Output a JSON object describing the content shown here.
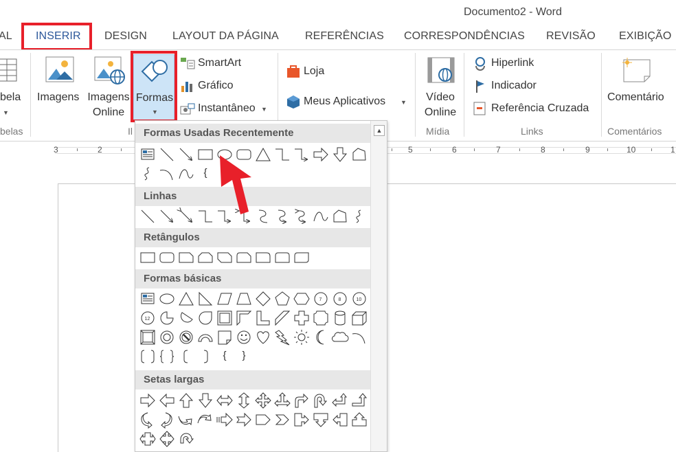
{
  "window": {
    "title": "Documento2 - Word"
  },
  "tabs": [
    {
      "label": "AL"
    },
    {
      "label": "INSERIR"
    },
    {
      "label": "DESIGN"
    },
    {
      "label": "LAYOUT DA PÁGINA"
    },
    {
      "label": "REFERÊNCIAS"
    },
    {
      "label": "CORRESPONDÊNCIAS"
    },
    {
      "label": "REVISÃO"
    },
    {
      "label": "EXIBIÇÃO"
    }
  ],
  "ribbon": {
    "tabela": {
      "label": "bela",
      "group": "belas"
    },
    "imagens": {
      "label": "Imagens"
    },
    "imagens_online": {
      "line1": "Imagens",
      "line2": "Online"
    },
    "formas": {
      "label": "Formas"
    },
    "ilustr_group": "Il",
    "smartart": "SmartArt",
    "grafico": "Gráfico",
    "instantaneo": "Instantâneo",
    "loja": "Loja",
    "meus_aplicativos": "Meus Aplicativos",
    "video": {
      "line1": "Vídeo",
      "line2": "Online",
      "group": "Mídia"
    },
    "hiperlink": "Hiperlink",
    "indicador": "Indicador",
    "referencia_cruzada": "Referência Cruzada",
    "links_group": "Links",
    "comentario": "Comentário",
    "comentarios_group": "Comentários"
  },
  "ruler": {
    "numbers": [
      "3",
      "2",
      "5",
      "6",
      "7",
      "8",
      "9",
      "10",
      "1"
    ]
  },
  "shapes_menu": {
    "sections": [
      "Formas Usadas Recentemente",
      "Linhas",
      "Retângulos",
      "Formas básicas",
      "Setas largas"
    ],
    "brace_glyphs": {
      "open": "{",
      "close": "}"
    }
  },
  "colors": {
    "accent": "#2b579a",
    "highlight": "#e8202a"
  }
}
